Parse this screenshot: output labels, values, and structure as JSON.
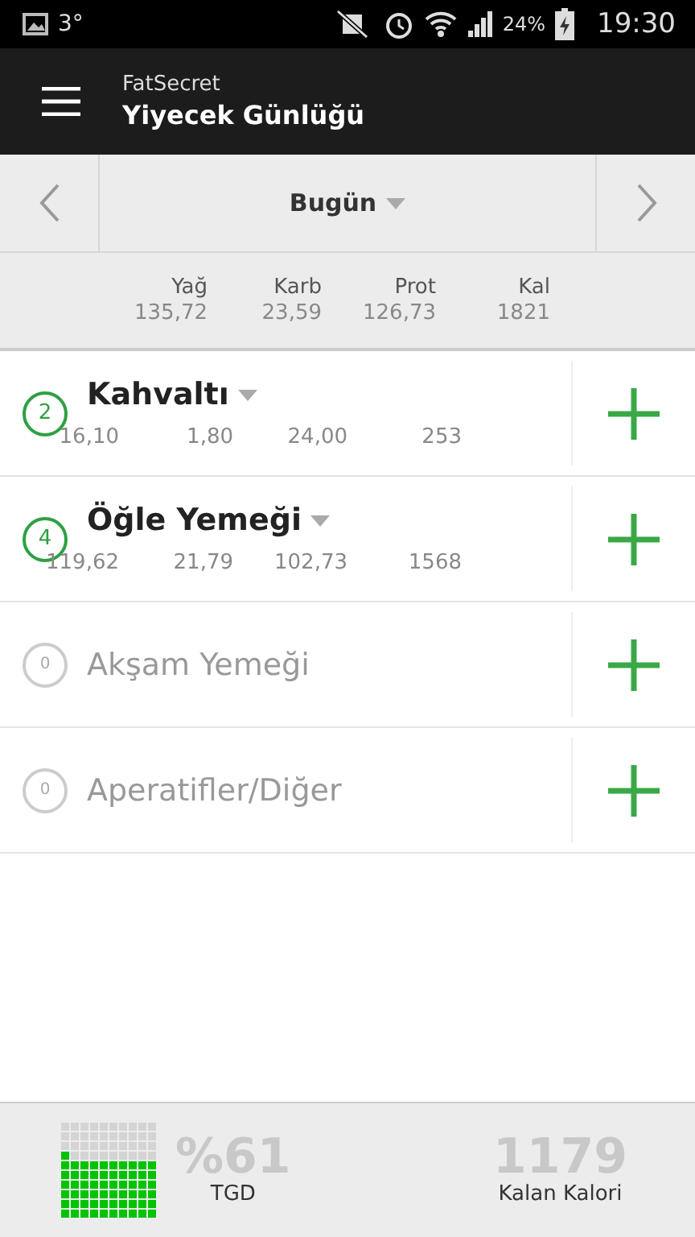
{
  "status_bar": {
    "temperature": "3°",
    "battery": "24%",
    "time": "19:30"
  },
  "app_bar": {
    "app_name": "FatSecret",
    "title": "Yiyecek Günlüğü"
  },
  "date_nav": {
    "label": "Bugün"
  },
  "totals": {
    "columns": [
      "Yağ",
      "Karb",
      "Prot",
      "Kal"
    ],
    "values": [
      "135,72",
      "23,59",
      "126,73",
      "1821"
    ]
  },
  "meals": [
    {
      "count": "2",
      "name": "Kahvaltı",
      "empty": false,
      "values": [
        "16,10",
        "1,80",
        "24,00",
        "253"
      ]
    },
    {
      "count": "4",
      "name": "Öğle Yemeği",
      "empty": false,
      "values": [
        "119,62",
        "21,79",
        "102,73",
        "1568"
      ]
    },
    {
      "count": "0",
      "name": "Akşam Yemeği",
      "empty": true
    },
    {
      "count": "0",
      "name": "Aperatifler/Diğer",
      "empty": true
    }
  ],
  "footer": {
    "rdi": {
      "value": "%61",
      "label": "TGD"
    },
    "remaining": {
      "value": "1179",
      "label": "Kalan Kalori"
    }
  }
}
